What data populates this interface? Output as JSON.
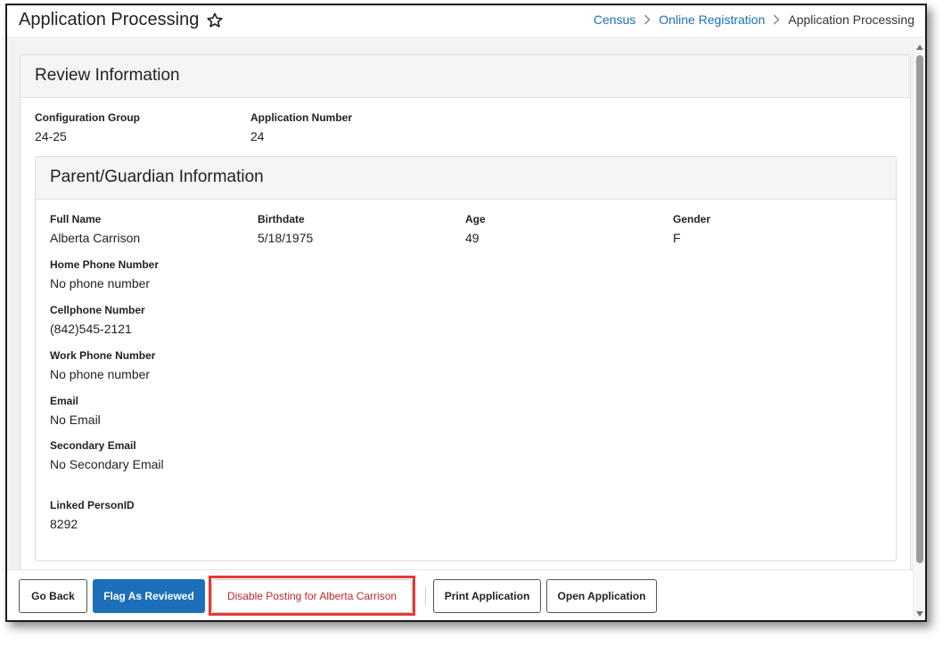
{
  "header": {
    "title": "Application Processing",
    "breadcrumb": [
      "Census",
      "Online Registration",
      "Application Processing"
    ]
  },
  "review": {
    "heading": "Review Information",
    "config_group_label": "Configuration Group",
    "config_group_value": "24-25",
    "app_number_label": "Application Number",
    "app_number_value": "24"
  },
  "guardian": {
    "heading": "Parent/Guardian Information",
    "full_name_label": "Full Name",
    "full_name_value": "Alberta Carrison",
    "birthdate_label": "Birthdate",
    "birthdate_value": "5/18/1975",
    "age_label": "Age",
    "age_value": "49",
    "gender_label": "Gender",
    "gender_value": "F",
    "home_phone_label": "Home Phone Number",
    "home_phone_value": "No phone number",
    "cell_phone_label": "Cellphone Number",
    "cell_phone_value": "(842)545-2121",
    "work_phone_label": "Work Phone Number",
    "work_phone_value": "No phone number",
    "email_label": "Email",
    "email_value": "No Email",
    "secondary_email_label": "Secondary Email",
    "secondary_email_value": "No Secondary Email",
    "linked_person_label": "Linked PersonID",
    "linked_person_value": "8292"
  },
  "footer": {
    "go_back": "Go Back",
    "flag_reviewed": "Flag As Reviewed",
    "disable_posting": "Disable Posting for Alberta Carrison",
    "print_application": "Print Application",
    "open_application": "Open Application"
  },
  "colors": {
    "accent": "#1d6fb8",
    "danger_text": "#c3262e",
    "highlight_border": "#e53935"
  },
  "icons": [
    "star-icon",
    "chevron-right-icon"
  ]
}
